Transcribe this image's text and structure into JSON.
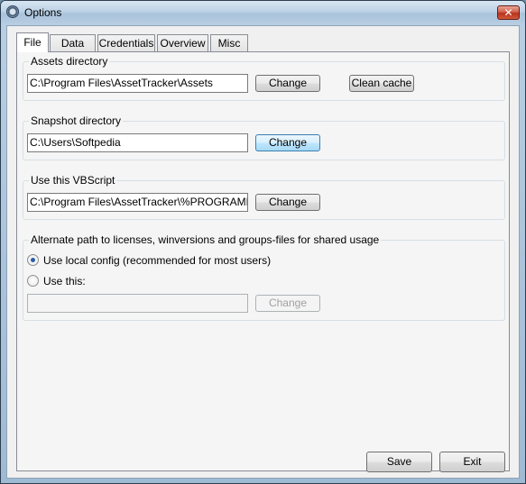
{
  "window": {
    "title": "Options",
    "close_glyph": "✕"
  },
  "tabs": [
    {
      "label": "File",
      "active": true
    },
    {
      "label": "Data"
    },
    {
      "label": "Credentials"
    },
    {
      "label": "Overview"
    },
    {
      "label": "Misc"
    }
  ],
  "assets": {
    "label": "Assets directory",
    "value": "C:\\Program Files\\AssetTracker\\Assets",
    "change": "Change",
    "clean_cache": "Clean cache"
  },
  "snapshot": {
    "label": "Snapshot directory",
    "value": "C:\\Users\\Softpedia",
    "change": "Change"
  },
  "vbscript": {
    "label": "Use this VBScript",
    "value": "C:\\Program Files\\AssetTracker\\%PROGRAMFILES",
    "change": "Change"
  },
  "alternate": {
    "label": "Alternate path to licenses, winversions and groups-files for shared usage",
    "option_local": "Use local config (recommended for most users)",
    "option_this": "Use this:",
    "selected": "local",
    "value": "",
    "change": "Change"
  },
  "footer": {
    "save": "Save",
    "exit": "Exit"
  }
}
